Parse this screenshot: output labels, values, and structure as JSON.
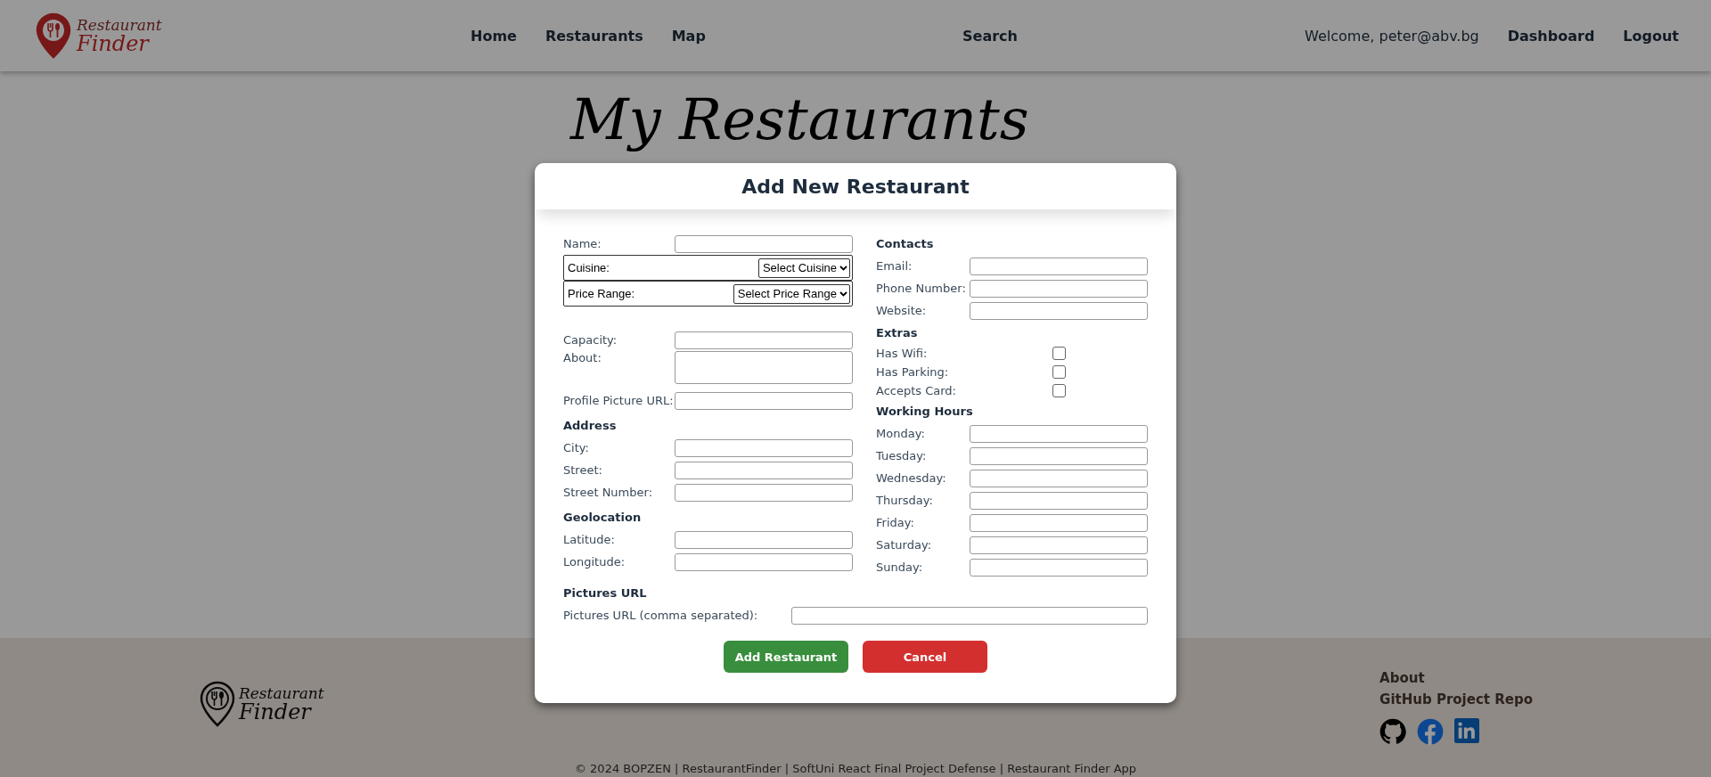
{
  "header": {
    "logo": {
      "line1": "Restaurant",
      "line2": "Finder"
    },
    "nav": [
      {
        "label": "Home"
      },
      {
        "label": "Restaurants"
      },
      {
        "label": "Map"
      }
    ],
    "search": "Search",
    "welcome": "Welcome, peter@abv.bg",
    "user_links": [
      {
        "label": "Dashboard"
      },
      {
        "label": "Logout"
      }
    ]
  },
  "page_title": "My Restaurants",
  "modal": {
    "title": "Add New Restaurant",
    "left": [
      {
        "kind": "input",
        "label": "Name:"
      },
      {
        "kind": "select",
        "label": "Cuisine:",
        "value": "Select Cuisine"
      },
      {
        "kind": "select",
        "label": "Price Range:",
        "value": "Select Price Range"
      },
      {
        "kind": "input",
        "label": "Capacity:"
      },
      {
        "kind": "textarea",
        "label": "About:"
      },
      {
        "kind": "input",
        "label": "Profile Picture URL:"
      },
      {
        "kind": "heading",
        "label": "Address"
      },
      {
        "kind": "input",
        "label": "City:"
      },
      {
        "kind": "input",
        "label": "Street:"
      },
      {
        "kind": "input",
        "label": "Street Number:"
      },
      {
        "kind": "heading",
        "label": "Geolocation"
      },
      {
        "kind": "input",
        "label": "Latitude:"
      },
      {
        "kind": "input",
        "label": "Longitude:"
      }
    ],
    "right": [
      {
        "kind": "heading",
        "label": "Contacts"
      },
      {
        "kind": "input",
        "label": "Email:"
      },
      {
        "kind": "input",
        "label": "Phone Number:"
      },
      {
        "kind": "input",
        "label": "Website:"
      },
      {
        "kind": "heading",
        "label": "Extras"
      },
      {
        "kind": "checkbox",
        "label": "Has Wifi:",
        "checked": false
      },
      {
        "kind": "checkbox",
        "label": "Has Parking:",
        "checked": false
      },
      {
        "kind": "checkbox",
        "label": "Accepts Card:",
        "checked": false
      },
      {
        "kind": "heading",
        "label": "Working Hours"
      },
      {
        "kind": "input",
        "label": "Monday:"
      },
      {
        "kind": "input",
        "label": "Tuesday:"
      },
      {
        "kind": "input",
        "label": "Wednesday:"
      },
      {
        "kind": "input",
        "label": "Thursday:"
      },
      {
        "kind": "input",
        "label": "Friday:"
      },
      {
        "kind": "input",
        "label": "Saturday:"
      },
      {
        "kind": "input",
        "label": "Sunday:"
      }
    ],
    "pictures": {
      "heading": "Pictures URL",
      "label": "Pictures URL (comma separated):"
    },
    "buttons": [
      {
        "label": "Add Restaurant",
        "kind": "primary"
      },
      {
        "label": "Cancel",
        "kind": "danger"
      }
    ]
  },
  "footer": {
    "logo": {
      "line1": "Restaurant",
      "line2": "Finder"
    },
    "links": [
      {
        "label": "About"
      },
      {
        "label": "GitHub Project Repo"
      }
    ],
    "social": [
      {
        "kind": "github"
      },
      {
        "kind": "facebook"
      },
      {
        "kind": "linkedin"
      }
    ],
    "copyright": "© 2024 BOPZEN | RestaurantFinder | SoftUni React Final Project Defense | Restaurant Finder App"
  }
}
